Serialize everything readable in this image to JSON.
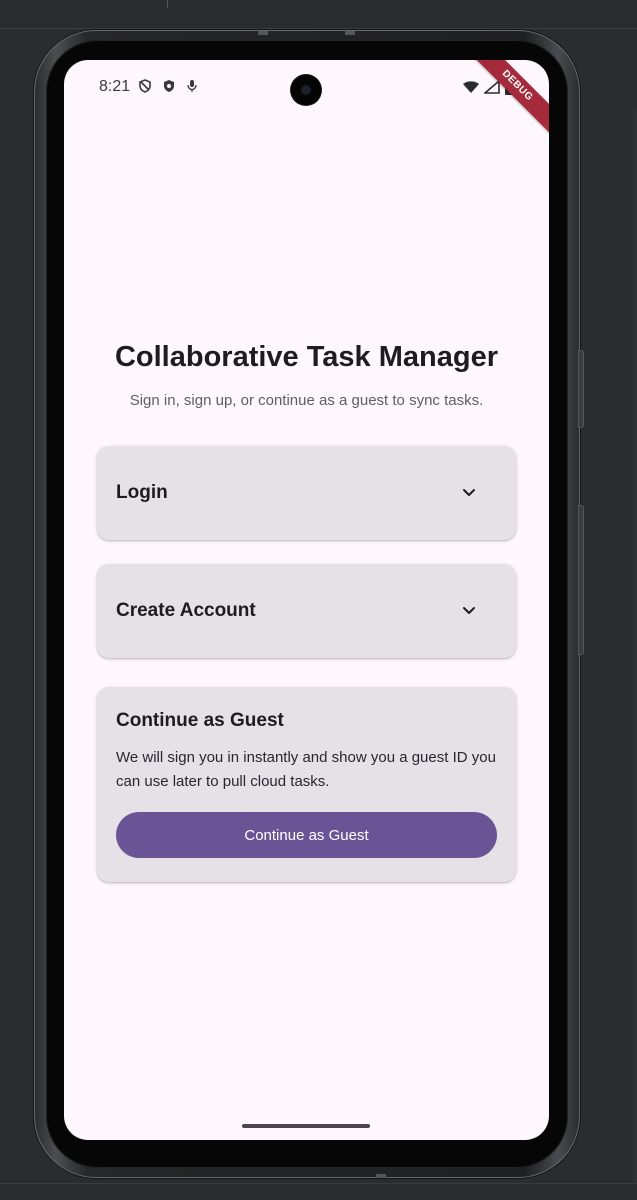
{
  "status_bar": {
    "time": "8:21",
    "left_icons": [
      "vpn-key-icon",
      "shield-icon",
      "mic-icon"
    ],
    "right_icons": [
      "wifi-icon",
      "cellular-signal-icon",
      "battery-icon"
    ]
  },
  "debug_banner": {
    "label": "DEBUG"
  },
  "header": {
    "title": "Collaborative Task Manager",
    "subtitle": "Sign in, sign up, or continue as a guest to sync tasks."
  },
  "panels": {
    "login": {
      "title": "Login",
      "icon": "chevron-down-icon"
    },
    "create_account": {
      "title": "Create Account",
      "icon": "chevron-down-icon"
    },
    "guest": {
      "title": "Continue as Guest",
      "description": "We will sign you in instantly and show you a guest ID you can use later to pull cloud tasks.",
      "button_label": "Continue as Guest"
    }
  },
  "colors": {
    "screen_background": "#fff7fe",
    "panel_background": "#e6e0e7",
    "primary_button": "#6b5495",
    "debug_banner": "#a42a3c",
    "title_text": "#1f1b23",
    "subtitle_text": "#625b68"
  }
}
